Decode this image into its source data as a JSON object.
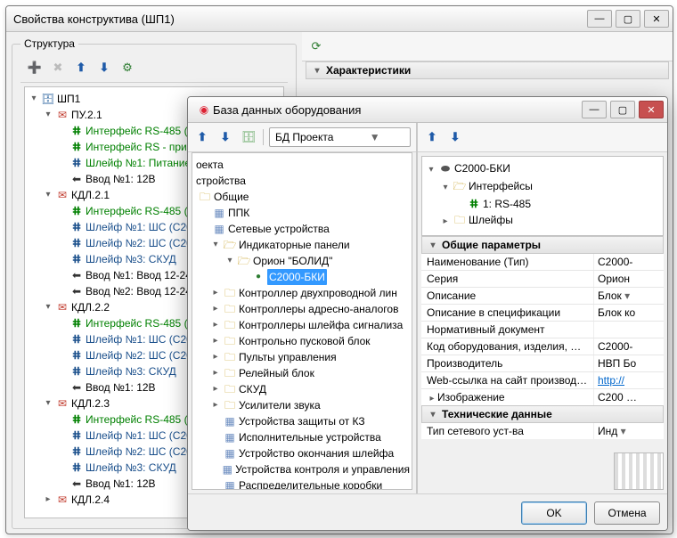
{
  "mainWindow": {
    "title": "Свойства конструктива (ШП1)",
    "structureLabel": "Структура",
    "characteristicsLabel": "Характеристики",
    "tree": {
      "root": "ШП1",
      "pu": "ПУ.2.1",
      "rs1": "Интерфейс RS-485 (",
      "rs2": "Интерфейс RS - при",
      "loop_power": "Шлейф №1: Питание",
      "in1_12v": "Ввод №1: 12В",
      "kdl21": "КДЛ.2.1",
      "kdl21_rs": "Интерфейс RS-485 (",
      "kdl21_s1": "Шлейф №1: ШС  (С20",
      "kdl21_s2": "Шлейф №2: ШС  (С20",
      "kdl21_s3": "Шлейф №3: СКУД",
      "kdl21_in1": "Ввод №1: Ввод 12-24",
      "kdl21_in2": "Ввод №2: Ввод 12-24",
      "kdl22": "КДЛ.2.2",
      "kdl22_rs": "Интерфейс RS-485 (",
      "kdl22_s1": "Шлейф №1: ШС  (С20",
      "kdl22_s2": "Шлейф №2: ШС  (С20",
      "kdl22_s3": "Шлейф №3: СКУД",
      "kdl22_in": "Ввод №1: 12В",
      "kdl23": "КДЛ.2.3",
      "kdl23_rs": "Интерфейс RS-485 (",
      "kdl23_s1": "Шлейф №1: ШС  (С20",
      "kdl23_s2": "Шлейф №2: ШС  (С20",
      "kdl23_s3": "Шлейф №3: СКУД",
      "kdl23_in": "Ввод №1: 12В",
      "kdl24": "КДЛ.2.4"
    }
  },
  "dbWindow": {
    "title": "База данных оборудования",
    "combo": "БД Проекта",
    "leftTree": {
      "l1": "оекта",
      "l2": "стройства",
      "common": "Общие",
      "ppk": "ППК",
      "netdev": "Сетевые устройства",
      "indpanels": "Индикаторные панели",
      "orion": "Орион \"БОЛИД\"",
      "bki": "С2000-БКИ",
      "ctrl2w": "Контроллер двухпроводной лин",
      "ctrlAddr": "Контроллеры адресно-аналогов",
      "ctrlLoop": "Контроллеры шлейфа сигнализа",
      "kpb": "Контрольно пусковой блок",
      "pulty": "Пульты управления",
      "relay": "Релейный блок",
      "skud": "СКУД",
      "amp": "Усилители звука",
      "kz": "Устройства защиты от КЗ",
      "exec": "Исполнительные устройства",
      "loopEnd": "Устройство окончания шлейфа",
      "ctrlMgmt": "Устройства контроля и управления",
      "distBox": "Распределительные коробки"
    },
    "rightTree": {
      "root": "С2000-БКИ",
      "ifaces": "Интерфейсы",
      "rs485": "1: RS-485",
      "loops": "Шлейфы"
    },
    "props": {
      "headGeneral": "Общие параметры",
      "name_k": "Наименование (Тип)",
      "name_v": "С2000-",
      "series_k": "Серия",
      "series_v": "Орион",
      "desc_k": "Описание",
      "desc_v": "Блок",
      "spec_k": "Описание в спецификации",
      "spec_v": "Блок ко",
      "norm_k": "Нормативный документ",
      "norm_v": "",
      "code_k": "Код оборудования, изделия, мат…",
      "code_v": "С2000-",
      "maker_k": "Производитель",
      "maker_v": "НВП Бо",
      "web_k": "Web-ссылка на сайт производит…",
      "web_v": "http://",
      "img_k": "Изображение",
      "img_v": "С200",
      "headTech": "Технические данные",
      "nettype_k": "Тип сетевого уст-ва",
      "nettype_v": "Инд"
    },
    "buttons": {
      "ok": "OK",
      "cancel": "Отмена"
    }
  }
}
